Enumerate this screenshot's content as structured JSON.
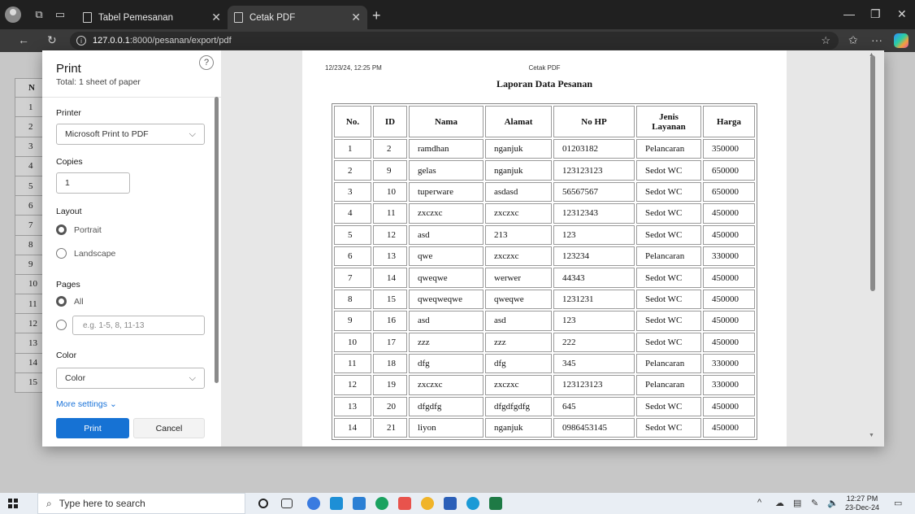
{
  "browser": {
    "tabs": [
      {
        "title": "Tabel Pemesanan"
      },
      {
        "title": "Cetak PDF"
      }
    ],
    "url_host": "127.0.0.1",
    "url_rest": ":8000/pesanan/export/pdf"
  },
  "background_rows": [
    "N",
    "1",
    "2",
    "3",
    "4",
    "5",
    "6",
    "7",
    "8",
    "9",
    "10",
    "11",
    "12",
    "13",
    "14",
    "15"
  ],
  "print_dialog": {
    "title": "Print",
    "subtitle": "Total: 1 sheet of paper",
    "help": "?",
    "printer_label": "Printer",
    "printer_value": "Microsoft Print to PDF",
    "copies_label": "Copies",
    "copies_value": "1",
    "layout_label": "Layout",
    "portrait": "Portrait",
    "landscape": "Landscape",
    "pages_label": "Pages",
    "pages_all": "All",
    "pages_placeholder": "e.g. 1-5, 8, 11-13",
    "color_label": "Color",
    "color_value": "Color",
    "more_settings": "More settings",
    "print_button": "Print",
    "cancel_button": "Cancel"
  },
  "document": {
    "header_datetime": "12/23/24, 12:25 PM",
    "header_title": "Cetak PDF",
    "title": "Laporan Data Pesanan",
    "columns": [
      "No.",
      "ID",
      "Nama",
      "Alamat",
      "No HP",
      "Jenis Layanan",
      "Harga"
    ],
    "rows": [
      [
        "1",
        "2",
        "ramdhan",
        "nganjuk",
        "01203182",
        "Pelancaran",
        "350000"
      ],
      [
        "2",
        "9",
        "gelas",
        "nganjuk",
        "123123123",
        "Sedot WC",
        "650000"
      ],
      [
        "3",
        "10",
        "tuperware",
        "asdasd",
        "56567567",
        "Sedot WC",
        "650000"
      ],
      [
        "4",
        "11",
        "zxczxc",
        "zxczxc",
        "12312343",
        "Sedot WC",
        "450000"
      ],
      [
        "5",
        "12",
        "asd",
        "213",
        "123",
        "Sedot WC",
        "450000"
      ],
      [
        "6",
        "13",
        "qwe",
        "zxczxc",
        "123234",
        "Pelancaran",
        "330000"
      ],
      [
        "7",
        "14",
        "qweqwe",
        "werwer",
        "44343",
        "Sedot WC",
        "450000"
      ],
      [
        "8",
        "15",
        "qweqweqwe",
        "qweqwe",
        "1231231",
        "Sedot WC",
        "450000"
      ],
      [
        "9",
        "16",
        "asd",
        "asd",
        "123",
        "Sedot WC",
        "450000"
      ],
      [
        "10",
        "17",
        "zzz",
        "zzz",
        "222",
        "Sedot WC",
        "450000"
      ],
      [
        "11",
        "18",
        "dfg",
        "dfg",
        "345",
        "Pelancaran",
        "330000"
      ],
      [
        "12",
        "19",
        "zxczxc",
        "zxczxc",
        "123123123",
        "Pelancaran",
        "330000"
      ],
      [
        "13",
        "20",
        "dfgdfg",
        "dfgdfgdfg",
        "645",
        "Sedot WC",
        "450000"
      ],
      [
        "14",
        "21",
        "liyon",
        "nganjuk",
        "0986453145",
        "Sedot WC",
        "450000"
      ]
    ]
  },
  "taskbar": {
    "search_placeholder": "Type here to search",
    "time": "12:27 PM",
    "date": "23-Dec-24"
  }
}
